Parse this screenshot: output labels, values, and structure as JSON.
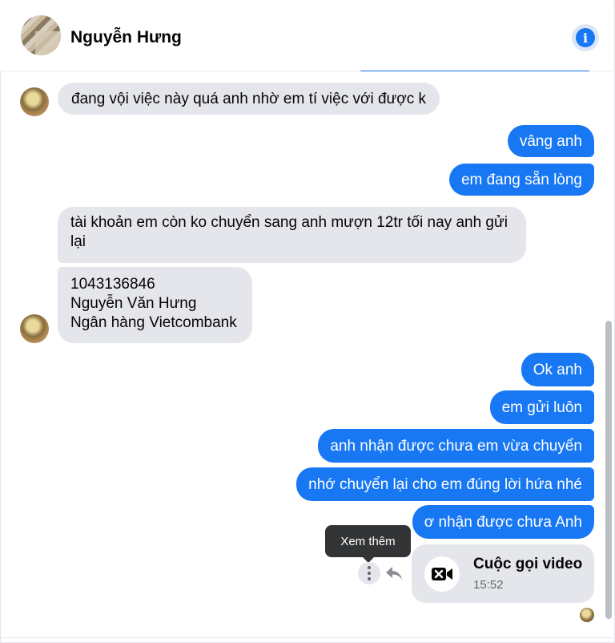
{
  "header": {
    "contact_name": "Nguyễn Hưng",
    "info_icon": "i"
  },
  "messages": [
    {
      "direction": "incoming",
      "text": "đang vội việc này quá anh nhờ em tí việc với được k"
    },
    {
      "direction": "outgoing",
      "text": "vâng anh"
    },
    {
      "direction": "outgoing",
      "text": "em đang sẵn lòng"
    },
    {
      "direction": "incoming",
      "lines": [
        "tài khoản em còn ko chuyển sang anh mượn 12tr tối nay anh gửi",
        "lại"
      ]
    },
    {
      "direction": "incoming",
      "lines": [
        "1043136846",
        "Nguyễn Văn Hưng",
        "Ngân hàng Vietcombank"
      ]
    },
    {
      "direction": "outgoing",
      "text": "Ok anh"
    },
    {
      "direction": "outgoing",
      "text": "em gửi luôn"
    },
    {
      "direction": "outgoing",
      "text": "anh nhận được chưa em vừa chuyển"
    },
    {
      "direction": "outgoing",
      "text": "nhớ chuyển lại cho em đúng lời hứa nhé"
    },
    {
      "direction": "outgoing",
      "text": "ơ nhận được chưa Anh"
    }
  ],
  "tooltip": {
    "text": "Xem thêm"
  },
  "video_call": {
    "title": "Cuộc gọi video",
    "time": "15:52"
  },
  "colors": {
    "outgoing_bubble": "#1877f2",
    "incoming_bubble": "#e4e6eb",
    "accent": "#1877f2"
  },
  "icons": {
    "more": "more-options-icon",
    "reply": "reply-icon",
    "call": "missed-video-call-icon"
  }
}
